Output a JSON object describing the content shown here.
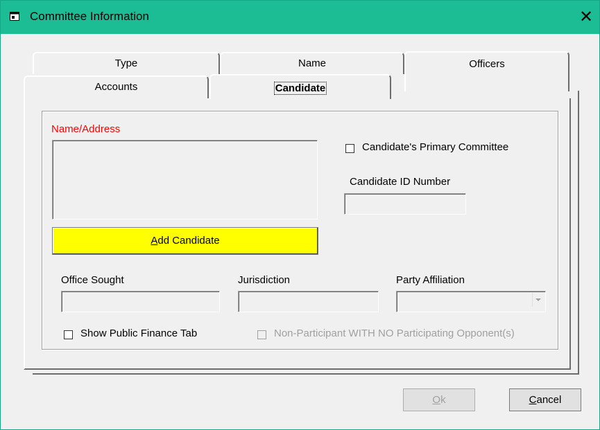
{
  "window": {
    "title": "Committee Information",
    "title_bar_color": "#1cbc95",
    "close_icon": "close-icon",
    "app_icon": "window-icon"
  },
  "tabs": {
    "type": "Type",
    "name": "Name",
    "officers": "Officers",
    "accounts": "Accounts",
    "candidate": "Candidate",
    "active": "Candidate"
  },
  "candidate_tab": {
    "name_address_label": "Name/Address",
    "name_address_value": "",
    "add_candidate_button": "Add Candidate",
    "add_candidate_accel": "A",
    "add_candidate_rest": "dd Candidate",
    "primary_committee_label": "Candidate's Primary Committee",
    "primary_committee_checked": false,
    "candidate_id_label": "Candidate ID Number",
    "candidate_id_value": "",
    "office_sought_label": "Office Sought",
    "office_sought_value": "",
    "jurisdiction_label": "Jurisdiction",
    "jurisdiction_value": "",
    "party_affiliation_label": "Party Affiliation",
    "party_affiliation_value": "",
    "show_public_finance_label": "Show Public Finance Tab",
    "show_public_finance_checked": false,
    "non_participant_label": "Non-Participant WITH NO Participating Opponent(s)",
    "non_participant_checked": false,
    "non_participant_enabled": false
  },
  "footer": {
    "ok_accel": "O",
    "ok_rest": "k",
    "ok_enabled": false,
    "cancel_accel": "C",
    "cancel_rest": "ancel"
  },
  "colors": {
    "add_candidate_bg": "#ffff00",
    "required_label": "#ff0000"
  }
}
